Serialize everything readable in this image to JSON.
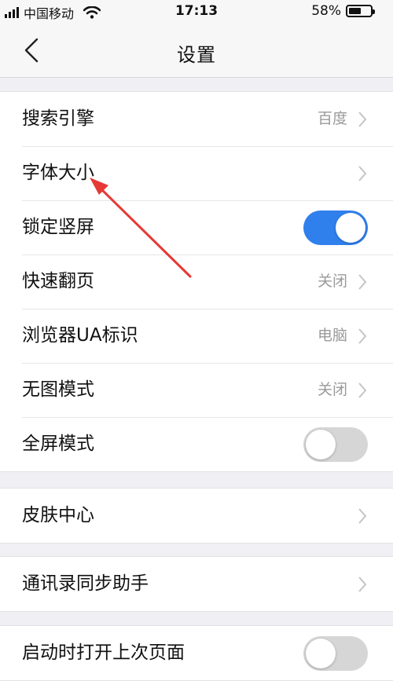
{
  "status_bar": {
    "carrier": "中国移动",
    "time": "17:13",
    "battery_percent": "58%",
    "battery_level": 0.58,
    "signal_icon": "signal-bars-icon",
    "wifi_icon": "wifi-icon",
    "battery_icon": "battery-icon"
  },
  "nav": {
    "title": "设置",
    "back_icon": "chevron-left-icon"
  },
  "colors": {
    "accent": "#2f80ed",
    "annotation": "#e53935"
  },
  "settings": {
    "group1": [
      {
        "label": "搜索引擎",
        "value": "百度"
      },
      {
        "label": "字体大小",
        "value": ""
      },
      {
        "label": "锁定竖屏",
        "toggle": true
      },
      {
        "label": "快速翻页",
        "value": "关闭"
      },
      {
        "label": "浏览器UA标识",
        "value": "电脑"
      },
      {
        "label": "无图模式",
        "value": "关闭"
      },
      {
        "label": "全屏模式",
        "toggle": false
      }
    ],
    "group2": [
      {
        "label": "皮肤中心"
      }
    ],
    "group3": [
      {
        "label": "通讯录同步助手"
      }
    ],
    "group4": [
      {
        "label": "启动时打开上次页面",
        "toggle": false
      }
    ]
  }
}
